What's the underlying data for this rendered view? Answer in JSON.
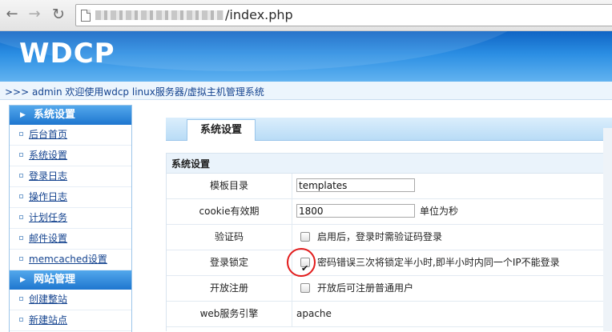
{
  "browser": {
    "url_visible": "/index.php"
  },
  "app": {
    "logo": "WDCP",
    "welcome": ">>> admin 欢迎使用wdcp linux服务器/虚拟主机管理系统"
  },
  "sidebar": {
    "sections": [
      {
        "title": "系统设置",
        "items": [
          "后台首页",
          "系统设置",
          "登录日志",
          "操作日志",
          "计划任务",
          "邮件设置",
          "memcached设置"
        ]
      },
      {
        "title": "网站管理",
        "items": [
          "创建整站",
          "新建站点"
        ]
      }
    ]
  },
  "main": {
    "tab": "系统设置",
    "panel_title": "系统设置",
    "rows": {
      "template_dir": {
        "label": "模板目录",
        "value": "templates"
      },
      "cookie": {
        "label": "cookie有效期",
        "value": "1800",
        "unit": "单位为秒"
      },
      "captcha": {
        "label": "验证码",
        "checked": false,
        "hint": "启用后，登录时需验证码登录"
      },
      "login_lock": {
        "label": "登录锁定",
        "checked": true,
        "hint": "密码错误三次将锁定半小时,即半小时内同一个IP不能登录"
      },
      "register": {
        "label": "开放注册",
        "checked": false,
        "hint": "开放后可注册普通用户"
      },
      "web_engine": {
        "label": "web服务引擎",
        "value": "apache"
      }
    }
  }
}
